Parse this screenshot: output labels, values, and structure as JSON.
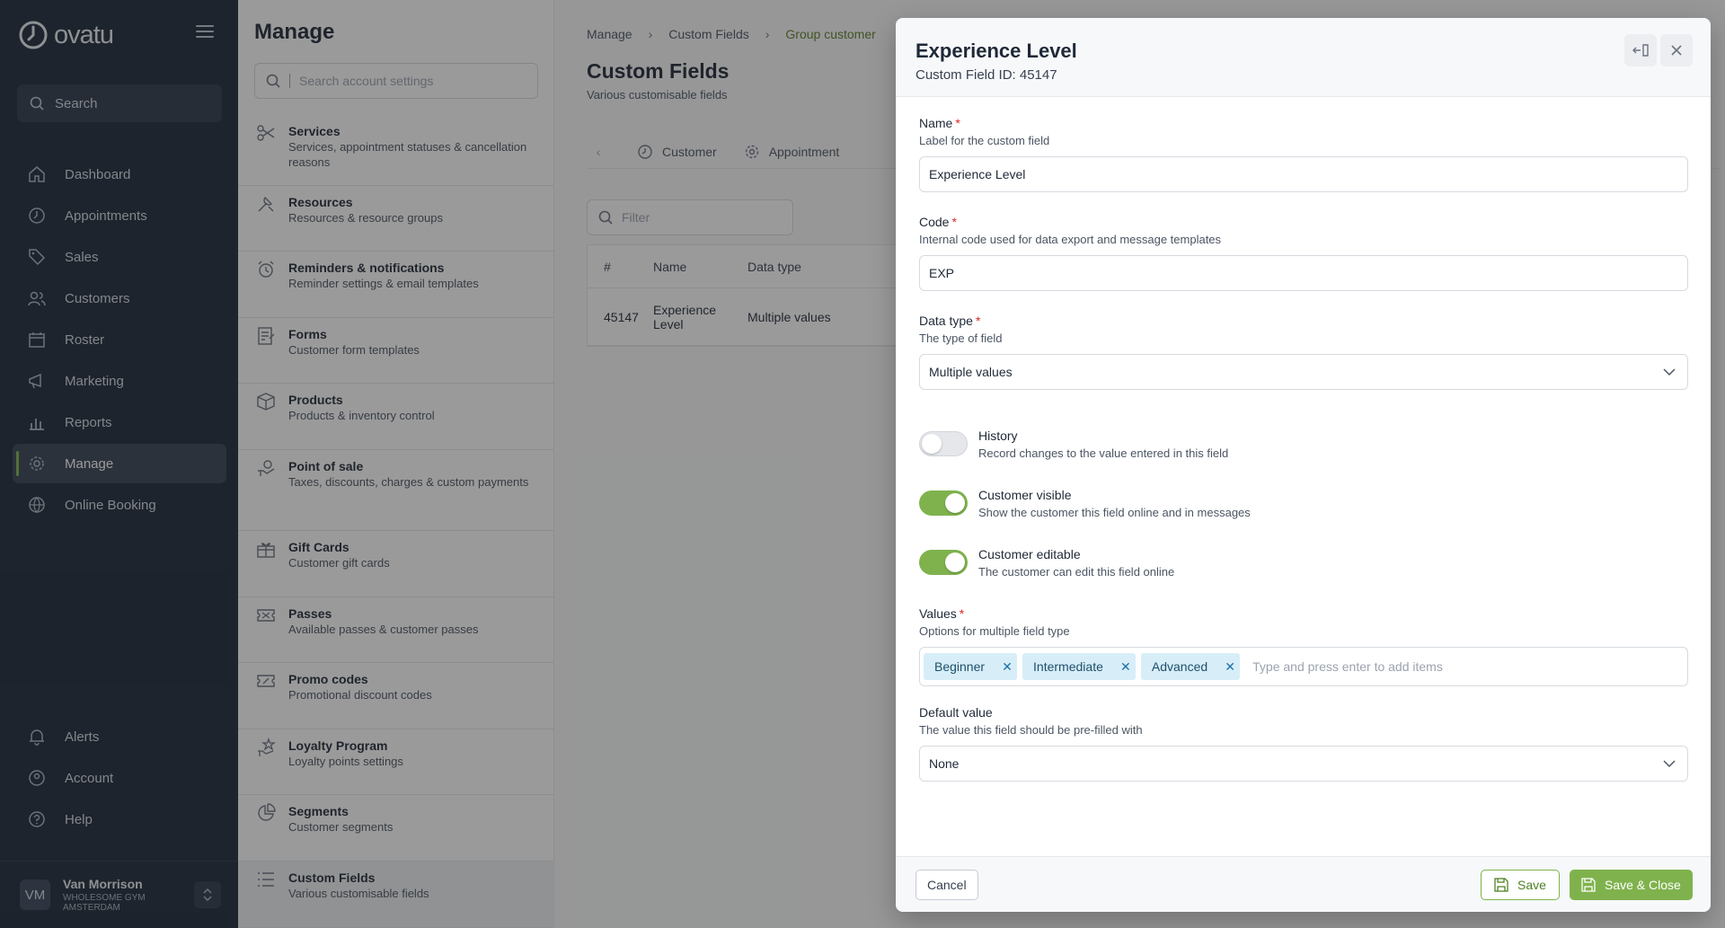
{
  "sidebar": {
    "brand": "ovatu",
    "search_label": "Search",
    "nav": [
      {
        "label": "Dashboard",
        "icon": "home-icon"
      },
      {
        "label": "Appointments",
        "icon": "clock-icon"
      },
      {
        "label": "Sales",
        "icon": "tag-icon"
      },
      {
        "label": "Customers",
        "icon": "users-icon"
      },
      {
        "label": "Roster",
        "icon": "calendar-icon"
      },
      {
        "label": "Marketing",
        "icon": "megaphone-icon"
      },
      {
        "label": "Reports",
        "icon": "chart-icon"
      },
      {
        "label": "Manage",
        "icon": "gear-icon"
      },
      {
        "label": "Online Booking",
        "icon": "globe-icon"
      }
    ],
    "bottom_nav": [
      {
        "label": "Alerts",
        "icon": "bell-icon"
      },
      {
        "label": "Account",
        "icon": "account-icon"
      },
      {
        "label": "Help",
        "icon": "help-icon"
      }
    ],
    "user": {
      "initials": "VM",
      "name": "Van Morrison",
      "org": "WHOLESOME GYM AMSTERDAM"
    }
  },
  "manage": {
    "title": "Manage",
    "search_placeholder": "Search account settings",
    "items": [
      {
        "title": "Services",
        "subtitle": "Services, appointment statuses & cancellation reasons"
      },
      {
        "title": "Resources",
        "subtitle": "Resources & resource groups"
      },
      {
        "title": "Reminders & notifications",
        "subtitle": "Reminder settings & email templates"
      },
      {
        "title": "Forms",
        "subtitle": "Customer form templates"
      },
      {
        "title": "Products",
        "subtitle": "Products & inventory control"
      },
      {
        "title": "Point of sale",
        "subtitle": "Taxes, discounts, charges & custom payments"
      },
      {
        "title": "Gift Cards",
        "subtitle": "Customer gift cards"
      },
      {
        "title": "Passes",
        "subtitle": "Available passes & customer passes"
      },
      {
        "title": "Promo codes",
        "subtitle": "Promotional discount codes"
      },
      {
        "title": "Loyalty Program",
        "subtitle": "Loyalty points settings"
      },
      {
        "title": "Segments",
        "subtitle": "Customer segments"
      },
      {
        "title": "Custom Fields",
        "subtitle": "Various customisable fields"
      }
    ]
  },
  "main": {
    "breadcrumbs": [
      "Manage",
      "Custom Fields",
      "Group customer"
    ],
    "title": "Custom Fields",
    "subtitle": "Various customisable fields",
    "tabs": [
      "Customer",
      "Appointment"
    ],
    "filter_placeholder": "Filter",
    "table": {
      "headers": [
        "#",
        "Name",
        "Data type"
      ],
      "rows": [
        {
          "id": "45147",
          "name": "Experience Level",
          "type": "Multiple values"
        }
      ]
    }
  },
  "modal": {
    "title": "Experience Level",
    "subtitle": "Custom Field ID: 45147",
    "name": {
      "label": "Name",
      "help": "Label for the custom field",
      "value": "Experience Level"
    },
    "code": {
      "label": "Code",
      "help": "Internal code used for data export and message templates",
      "value": "EXP"
    },
    "datatype": {
      "label": "Data type",
      "help": "The type of field",
      "value": "Multiple values"
    },
    "history": {
      "label": "History",
      "help": "Record changes to the value entered in this field",
      "on": false
    },
    "visible": {
      "label": "Customer visible",
      "help": "Show the customer this field online and in messages",
      "on": true
    },
    "editable": {
      "label": "Customer editable",
      "help": "The customer can edit this field online",
      "on": true
    },
    "values": {
      "label": "Values",
      "help": "Options for multiple field type",
      "tags": [
        "Beginner",
        "Intermediate",
        "Advanced"
      ],
      "placeholder": "Type and press enter to add items"
    },
    "default": {
      "label": "Default value",
      "help": "The value this field should be pre-filled with",
      "value": "None"
    },
    "footer": {
      "cancel": "Cancel",
      "save": "Save",
      "save_close": "Save & Close"
    }
  },
  "colors": {
    "accent": "#7fb24d",
    "sidebar": "#1d2839",
    "tag": "#d7eef8"
  }
}
